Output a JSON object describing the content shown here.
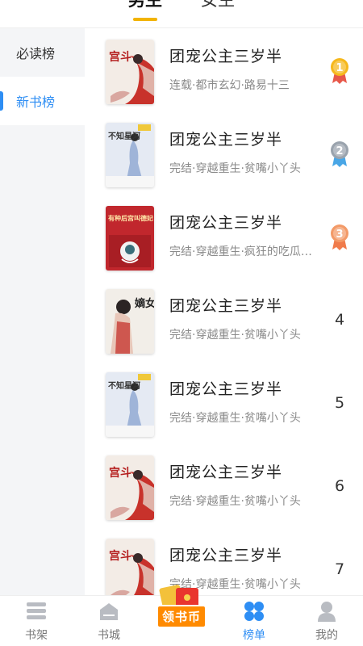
{
  "top_tabs": [
    "男生",
    "女生"
  ],
  "sidebar": {
    "items": [
      {
        "label": "必读榜",
        "active": false
      },
      {
        "label": "新书榜",
        "active": true
      }
    ]
  },
  "books": [
    {
      "title": "团宠公主三岁半",
      "meta": "连载·都市玄幻·路易十三",
      "rank": "1",
      "cover": "palace-red"
    },
    {
      "title": "团宠公主三岁半",
      "meta": "完结·穿越重生·贫嘴小丫头",
      "rank": "2",
      "cover": "blue-lady"
    },
    {
      "title": "团宠公主三岁半",
      "meta": "完结·穿越重生·疯狂的吃瓜群众",
      "rank": "3",
      "cover": "red-book"
    },
    {
      "title": "团宠公主三岁半",
      "meta": "完结·穿越重生·贫嘴小丫头",
      "rank": "4",
      "cover": "di-nv"
    },
    {
      "title": "团宠公主三岁半",
      "meta": "完结·穿越重生·贫嘴小丫头",
      "rank": "5",
      "cover": "blue-lady"
    },
    {
      "title": "团宠公主三岁半",
      "meta": "完结·穿越重生·贫嘴小丫头",
      "rank": "6",
      "cover": "palace-red"
    },
    {
      "title": "团宠公主三岁半",
      "meta": "完结·穿越重生·贫嘴小丫头",
      "rank": "7",
      "cover": "palace-red"
    }
  ],
  "cover_text": {
    "palace-red": "宫斗",
    "blue-lady": "不知星河",
    "red-book": "有种后宫叫德妃",
    "di-nv": "嫡女"
  },
  "medal_colors": {
    "1": "#f6b81c",
    "2": "#9aa3ad",
    "3": "#f39a68"
  },
  "medal_ribbons": {
    "1": "#e8584a",
    "2": "#49a6e6",
    "3": "#f07b4b"
  },
  "bottom_nav": [
    {
      "label": "书架",
      "icon": "bookshelf-icon",
      "active": false
    },
    {
      "label": "书城",
      "icon": "bookstore-icon",
      "active": false
    },
    {
      "label": "领书币",
      "icon": "red-envelope-icon",
      "promo": true
    },
    {
      "label": "榜单",
      "icon": "ranking-icon",
      "active": true
    },
    {
      "label": "我的",
      "icon": "profile-icon",
      "active": false
    }
  ],
  "colors": {
    "accent": "#2e8ef4",
    "tab_underline": "#f2b300"
  }
}
